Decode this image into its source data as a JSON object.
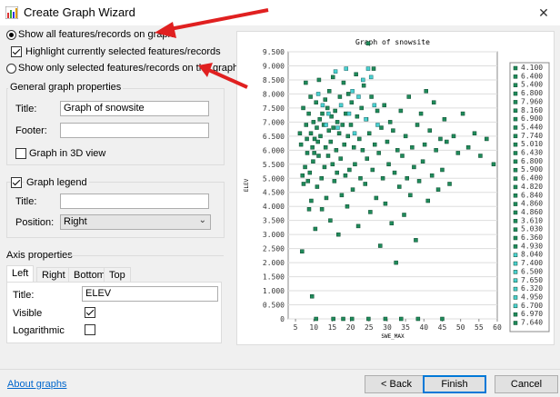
{
  "window": {
    "title": "Create Graph Wizard"
  },
  "display_options": {
    "show_all": "Show all features/records on graph",
    "highlight_selected": "Highlight currently selected features/records",
    "show_selected_only": "Show only selected features/records on the graph"
  },
  "general": {
    "group_title": "General graph properties",
    "title_label": "Title:",
    "title_value": "Graph of snowsite",
    "footer_label": "Footer:",
    "footer_value": "",
    "graph3d_label": "Graph in 3D view"
  },
  "legend": {
    "label": "Graph legend",
    "title_label": "Title:",
    "title_value": "",
    "position_label": "Position:",
    "position_value": "Right"
  },
  "axis": {
    "group_title": "Axis properties",
    "tabs": [
      "Left",
      "Right",
      "Bottom",
      "Top"
    ],
    "title_label": "Title:",
    "title_value": "ELEV",
    "visible_label": "Visible",
    "log_label": "Logarithmic"
  },
  "footer": {
    "about_link": "About graphs",
    "back": "< Back",
    "finish": "Finish",
    "cancel": "Cancel"
  },
  "chart_data": {
    "type": "scatter",
    "title": "Graph of snowsite",
    "xlabel": "SWE_MAX",
    "ylabel": "ELEV",
    "xlim": [
      3,
      60
    ],
    "ylim": [
      0,
      9.5
    ],
    "x_ticks": [
      "5",
      "10",
      "15",
      "20",
      "25",
      "30",
      "35",
      "40",
      "45",
      "50",
      "55",
      "60"
    ],
    "y_ticks": [
      "0",
      "0.500",
      "1.000",
      "1.500",
      "2.000",
      "2.500",
      "3.000",
      "3.500",
      "4.000",
      "4.500",
      "5.000",
      "5.500",
      "6.000",
      "6.500",
      "7.000",
      "7.500",
      "8.000",
      "8.500",
      "9.000",
      "9.500"
    ],
    "legend": [
      "4.100",
      "6.400",
      "5.400",
      "6.800",
      "7.960",
      "8.160",
      "6.900",
      "5.440",
      "7.740",
      "5.010",
      "6.430",
      "6.800",
      "5.900",
      "6.400",
      "4.820",
      "6.840",
      "4.860",
      "4.860",
      "3.610",
      "5.030",
      "6.360",
      "4.930",
      "8.040",
      "7.400",
      "6.500",
      "7.650",
      "6.320",
      "4.950",
      "6.700",
      "6.970",
      "7.640"
    ],
    "points": [
      [
        9.5,
        0.8
      ],
      [
        6.8,
        2.4
      ],
      [
        6.2,
        6.6
      ],
      [
        6.5,
        6.2
      ],
      [
        6.9,
        5.1
      ],
      [
        7.1,
        7.5
      ],
      [
        7.8,
        8.4
      ],
      [
        7.2,
        4.8
      ],
      [
        7.6,
        5.4
      ],
      [
        7.9,
        6.9
      ],
      [
        8.2,
        5.9
      ],
      [
        8.1,
        6.4
      ],
      [
        8.4,
        4.9
      ],
      [
        8.7,
        3.9
      ],
      [
        8.6,
        7.3
      ],
      [
        8.9,
        5.2
      ],
      [
        9.2,
        6.6
      ],
      [
        9.1,
        7.9
      ],
      [
        9.3,
        4.2
      ],
      [
        9.6,
        6.1
      ],
      [
        9.8,
        5.6
      ],
      [
        9.9,
        7.0
      ],
      [
        10.2,
        6.4
      ],
      [
        10.4,
        3.2
      ],
      [
        10.1,
        5.9
      ],
      [
        10.6,
        7.7
      ],
      [
        10.8,
        6.8
      ],
      [
        10.9,
        4.7
      ],
      [
        11.1,
        6.3
      ],
      [
        11.3,
        5.8
      ],
      [
        11.6,
        7.1
      ],
      [
        11.4,
        8.5
      ],
      [
        11.8,
        6.5
      ],
      [
        12.1,
        5.0
      ],
      [
        12.3,
        7.3
      ],
      [
        12.2,
        3.9
      ],
      [
        12.7,
        6.9
      ],
      [
        12.9,
        5.4
      ],
      [
        13.1,
        7.8
      ],
      [
        13.2,
        6.1
      ],
      [
        13.4,
        4.3
      ],
      [
        13.7,
        7.5
      ],
      [
        13.9,
        5.8
      ],
      [
        14.1,
        6.7
      ],
      [
        14.2,
        8.1
      ],
      [
        14.5,
        3.5
      ],
      [
        14.6,
        6.3
      ],
      [
        14.8,
        7.2
      ],
      [
        15.1,
        5.5
      ],
      [
        15.3,
        6.8
      ],
      [
        15.2,
        8.6
      ],
      [
        15.6,
        4.9
      ],
      [
        15.8,
        7.4
      ],
      [
        16.1,
        6.0
      ],
      [
        16.3,
        5.2
      ],
      [
        16.4,
        7.0
      ],
      [
        16.7,
        3.0
      ],
      [
        16.9,
        6.6
      ],
      [
        17.1,
        7.9
      ],
      [
        17.3,
        5.7
      ],
      [
        17.6,
        4.4
      ],
      [
        17.8,
        6.9
      ],
      [
        18.1,
        8.4
      ],
      [
        18.3,
        6.2
      ],
      [
        18.6,
        5.1
      ],
      [
        18.7,
        7.3
      ],
      [
        19.1,
        4.0
      ],
      [
        19.3,
        6.5
      ],
      [
        19.4,
        8.0
      ],
      [
        19.7,
        5.3
      ],
      [
        20.1,
        6.9
      ],
      [
        20.3,
        7.7
      ],
      [
        20.6,
        4.6
      ],
      [
        20.9,
        6.1
      ],
      [
        21.2,
        5.5
      ],
      [
        21.5,
        8.7
      ],
      [
        21.8,
        7.2
      ],
      [
        22.1,
        3.3
      ],
      [
        22.4,
        6.4
      ],
      [
        22.7,
        5.0
      ],
      [
        23.0,
        7.5
      ],
      [
        23.3,
        6.0
      ],
      [
        23.6,
        8.3
      ],
      [
        24.0,
        4.8
      ],
      [
        24.3,
        7.1
      ],
      [
        24.5,
        5.7
      ],
      [
        24.8,
        9.8
      ],
      [
        25.1,
        6.6
      ],
      [
        25.4,
        3.8
      ],
      [
        25.7,
        7.9
      ],
      [
        26.0,
        5.3
      ],
      [
        26.3,
        8.9
      ],
      [
        26.6,
        6.2
      ],
      [
        27.0,
        4.3
      ],
      [
        27.3,
        7.4
      ],
      [
        27.7,
        5.9
      ],
      [
        28.1,
        2.6
      ],
      [
        28.4,
        6.8
      ],
      [
        28.8,
        5.0
      ],
      [
        29.2,
        7.6
      ],
      [
        29.5,
        4.1
      ],
      [
        30.0,
        6.3
      ],
      [
        30.4,
        5.5
      ],
      [
        30.8,
        7.0
      ],
      [
        31.2,
        3.4
      ],
      [
        31.6,
        6.7
      ],
      [
        32.0,
        5.2
      ],
      [
        32.4,
        2.0
      ],
      [
        32.8,
        6.0
      ],
      [
        33.3,
        4.7
      ],
      [
        33.7,
        7.4
      ],
      [
        34.1,
        5.8
      ],
      [
        34.6,
        3.7
      ],
      [
        35.0,
        6.5
      ],
      [
        35.4,
        5.0
      ],
      [
        35.9,
        7.9
      ],
      [
        36.3,
        4.4
      ],
      [
        36.8,
        6.1
      ],
      [
        37.3,
        5.4
      ],
      [
        37.8,
        2.8
      ],
      [
        38.2,
        6.9
      ],
      [
        38.7,
        4.9
      ],
      [
        39.2,
        7.3
      ],
      [
        39.7,
        5.6
      ],
      [
        40.2,
        6.2
      ],
      [
        40.6,
        8.1
      ],
      [
        41.1,
        4.2
      ],
      [
        41.6,
        6.7
      ],
      [
        42.2,
        5.1
      ],
      [
        42.7,
        7.7
      ],
      [
        43.3,
        6.0
      ],
      [
        43.9,
        4.6
      ],
      [
        44.5,
        6.4
      ],
      [
        45.0,
        5.3
      ],
      [
        45.6,
        7.1
      ],
      [
        46.2,
        6.3
      ],
      [
        47.0,
        4.8
      ],
      [
        48.1,
        6.5
      ],
      [
        49.3,
        5.9
      ],
      [
        50.6,
        7.3
      ],
      [
        52.1,
        6.1
      ],
      [
        53.8,
        6.6
      ],
      [
        55.4,
        5.8
      ],
      [
        57.1,
        6.4
      ],
      [
        59.0,
        5.5
      ],
      [
        61.0,
        5.0
      ],
      [
        10.6,
        0.0
      ],
      [
        15.3,
        0.0
      ],
      [
        18.0,
        0.0
      ],
      [
        20.4,
        0.0
      ],
      [
        24.9,
        0.0
      ],
      [
        29.5,
        0.0
      ],
      [
        33.8,
        0.0
      ],
      [
        38.4,
        0.0
      ],
      [
        45.0,
        0.0
      ]
    ],
    "teal_points": [
      [
        11.2,
        8.0
      ],
      [
        12.4,
        7.6
      ],
      [
        13.3,
        6.9
      ],
      [
        14.0,
        7.3
      ],
      [
        15.9,
        8.8
      ],
      [
        16.5,
        6.8
      ],
      [
        17.4,
        7.6
      ],
      [
        18.8,
        8.9
      ],
      [
        19.6,
        7.3
      ],
      [
        20.5,
        8.1
      ],
      [
        21.1,
        6.6
      ],
      [
        22.2,
        7.9
      ],
      [
        23.4,
        8.5
      ],
      [
        24.2,
        7.1
      ],
      [
        24.8,
        8.9
      ],
      [
        25.6,
        8.6
      ],
      [
        26.5,
        7.6
      ],
      [
        27.4,
        6.9
      ]
    ]
  }
}
